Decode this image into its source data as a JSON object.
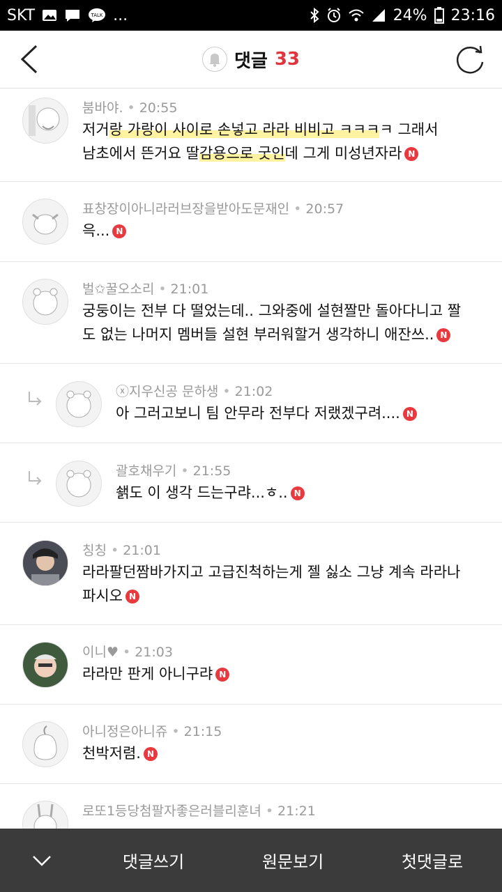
{
  "status": {
    "carrier": "SKT",
    "battery": "24%",
    "time": "23:16",
    "more": "..."
  },
  "header": {
    "title": "댓글",
    "count": "33"
  },
  "comments": [
    {
      "author": "붐바야.",
      "time": "20:55",
      "text_parts": [
        "저거",
        "랑 가랑이 사이로 손넣고 라라 비비고 ㅋㅋㅋ",
        "ㅋ 그래서",
        "남초에서 뜬거요 딸",
        "감용으로 굿인",
        "데 그게 미성년자라"
      ],
      "new": "N"
    },
    {
      "author": "표창장이아니라러브장을받아도문재인",
      "time": "20:57",
      "text": "윽...",
      "new": "N"
    },
    {
      "author": "벌✩꿀오소리",
      "time": "21:01",
      "text": "궁둥이는 전부 다 떨었는데.. 그와중에 설현짤만 돌아다니고 짤도 없는 나머지 멤버들 설현 부러워할거 생각하니 애잔쓰..",
      "new": "N"
    },
    {
      "author": "ⓧ지우신공 문하생",
      "time": "21:02",
      "text": "아 그러고보니 팀 안무라 전부다 저랬겠구려....",
      "new": "N",
      "reply": true
    },
    {
      "author": "괄호채우기",
      "time": "21:55",
      "text": "쇍도 이 생각 드는구랴...ㅎ..",
      "new": "N",
      "reply": true
    },
    {
      "author": "칭칭",
      "time": "21:01",
      "text": "라라팔던짬바가지고 고급진척하는게 젤 싫소 그냥 계속 라라나 파시오",
      "new": "N"
    },
    {
      "author": "이니♥",
      "time": "21:03",
      "text": "라라만 판게 아니구랴",
      "new": "N"
    },
    {
      "author": "아니정은아니쥬",
      "time": "21:15",
      "text": "천박저렴.",
      "new": "N"
    },
    {
      "author": "로또1등당첨팔자좋은러블리훈녀",
      "time": "21:21",
      "text": ""
    }
  ],
  "bottom": {
    "write": "댓글쓰기",
    "original": "원문보기",
    "first": "첫댓글로"
  },
  "colors": {
    "accent": "#e0343f",
    "bottombar": "#3b3b3b",
    "highlight": "#fff2a0"
  }
}
